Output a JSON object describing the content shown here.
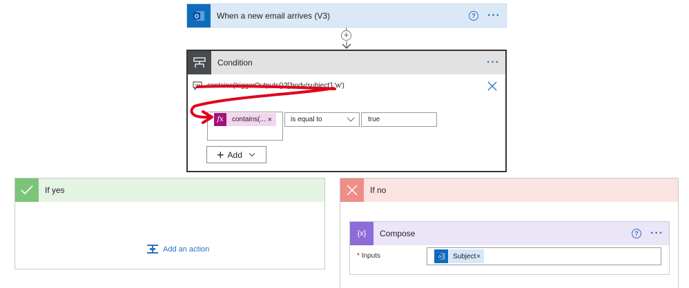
{
  "trigger": {
    "title": "When a new email arrives (V3)",
    "help": "?",
    "menu": "···"
  },
  "connector": {
    "plus": "+"
  },
  "condition": {
    "title": "Condition",
    "menu": "···",
    "expression": "contains(triggerOutputs()?['body/subject'],'w')",
    "left_token": {
      "label": "contains(...",
      "remove": "×",
      "icon": "fx"
    },
    "operator": "is equal to",
    "value": "true",
    "add_label": "Add"
  },
  "branch_yes": {
    "title": "If yes",
    "add_action": "Add an action"
  },
  "branch_no": {
    "title": "If no",
    "compose": {
      "title": "Compose",
      "icon_text": "{x}",
      "help": "?",
      "menu": "···",
      "inputs_required": "*",
      "inputs_label": "Inputs",
      "token": {
        "label": "Subject",
        "remove": "×"
      }
    }
  },
  "colors": {
    "trigger_bg": "#dbe9f7",
    "outlook_blue": "#0f6cbd",
    "condition_header": "#e2e2e2",
    "annotation_red": "#e0001a",
    "fx_magenta": "#a3127a",
    "yes_green": "#7bc47a",
    "no_red": "#ef8d88",
    "compose_purple": "#8c6cd8"
  }
}
